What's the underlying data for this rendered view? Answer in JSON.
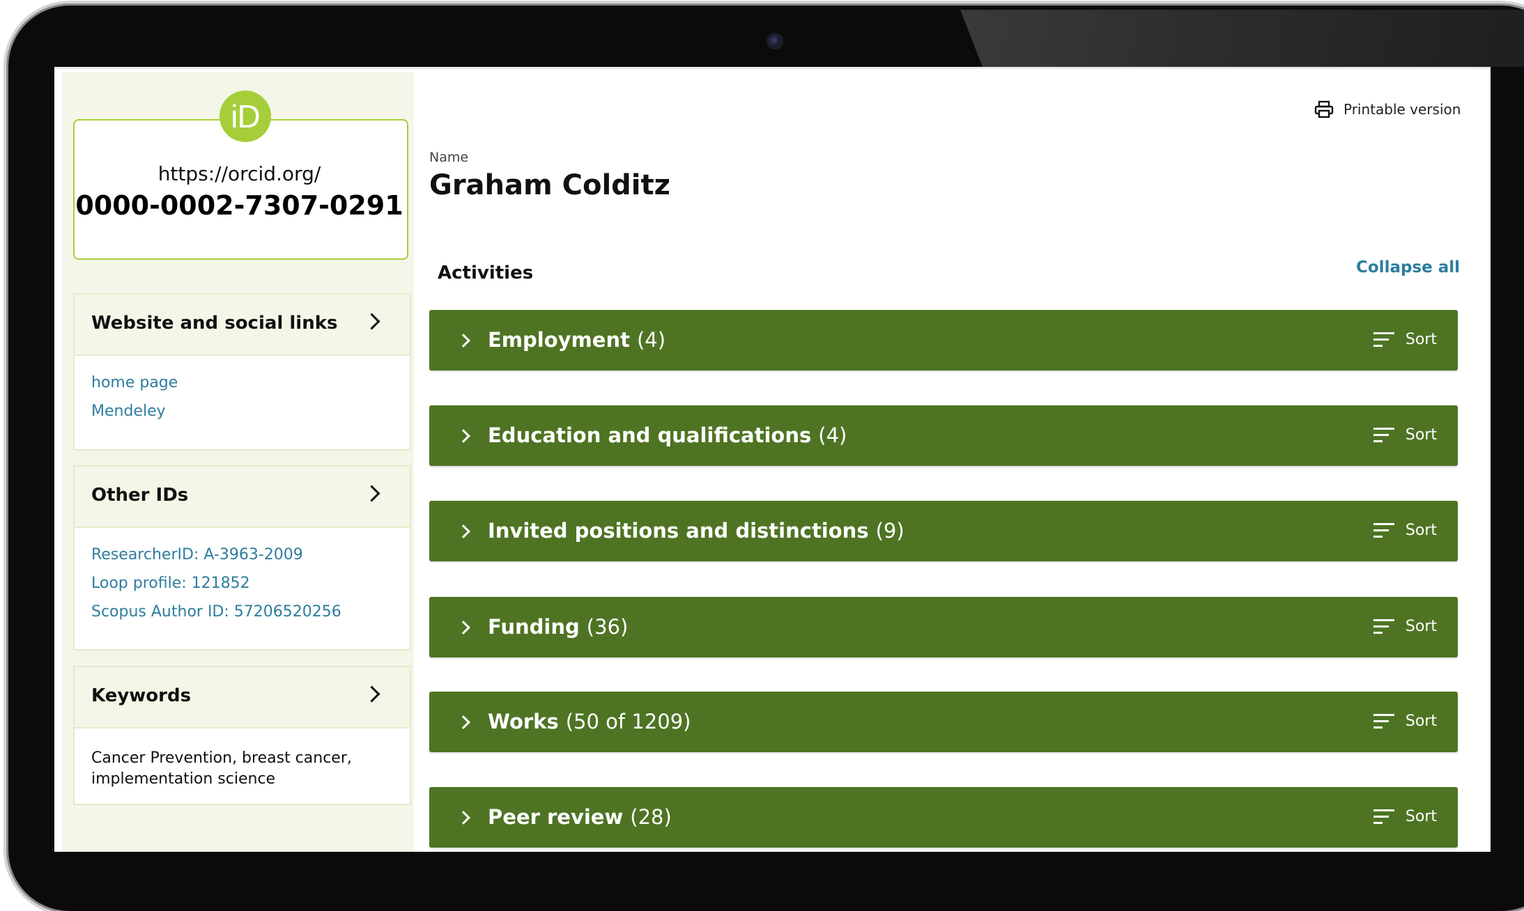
{
  "id_card": {
    "logo_text": "iD",
    "url": "https://orcid.org/",
    "orcid_id": "0000-0002-7307-0291"
  },
  "sidebar": {
    "websites": {
      "title": "Website and social links",
      "links": [
        "home page",
        "Mendeley"
      ]
    },
    "other_ids": {
      "title": "Other IDs",
      "links": [
        "ResearcherID: A-3963-2009",
        "Loop profile: 121852",
        "Scopus Author ID: 57206520256"
      ]
    },
    "keywords": {
      "title": "Keywords",
      "text": "Cancer Prevention, breast cancer, implementation science"
    }
  },
  "main": {
    "printable_label": "Printable version",
    "name_label": "Name",
    "name_value": "Graham Colditz",
    "activities_title": "Activities",
    "collapse_all": "Collapse all",
    "sections": [
      {
        "title": "Employment",
        "count": "(4)",
        "sort": "Sort"
      },
      {
        "title": "Education and qualifications",
        "count": "(4)",
        "sort": "Sort"
      },
      {
        "title": "Invited positions and distinctions",
        "count": "(9)",
        "sort": "Sort"
      },
      {
        "title": "Funding",
        "count": "(36)",
        "sort": "Sort"
      },
      {
        "title": "Works",
        "count": "(50 of 1209)",
        "sort": "Sort"
      },
      {
        "title": "Peer review",
        "count": "(28)",
        "sort": "Sort"
      }
    ]
  },
  "colors": {
    "section_green": "#4e7423",
    "orcid_green": "#a6ce39",
    "link_blue": "#2e7d9e",
    "sidebar_bg": "#f4f6e8"
  },
  "icons": [
    "orcid-logo",
    "printer-icon",
    "chevron-right-icon",
    "sort-icon"
  ]
}
